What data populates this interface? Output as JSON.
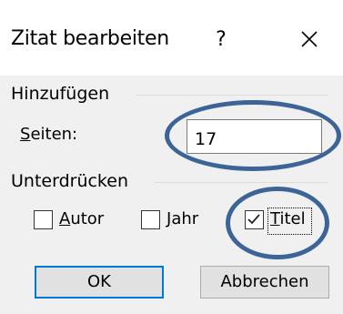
{
  "dialog": {
    "title": "Zitat bearbeiten",
    "help_label": "?",
    "close_icon": "close-icon"
  },
  "add_group": {
    "label": "Hinzufügen",
    "pages_label_accel": "S",
    "pages_label_rest": "eiten:",
    "pages_value": "17"
  },
  "suppress_group": {
    "label": "Unterdrücken",
    "checkboxes": [
      {
        "accel": "A",
        "rest": "utor",
        "checked": false
      },
      {
        "accel": "J",
        "rest": "ahr",
        "checked": false
      },
      {
        "accel": "T",
        "rest": "itel",
        "checked": true
      }
    ]
  },
  "buttons": {
    "ok_label": "OK",
    "cancel_label": "Abbrechen"
  },
  "colors": {
    "accent": "#0078d7",
    "annotation": "#3c6496"
  }
}
